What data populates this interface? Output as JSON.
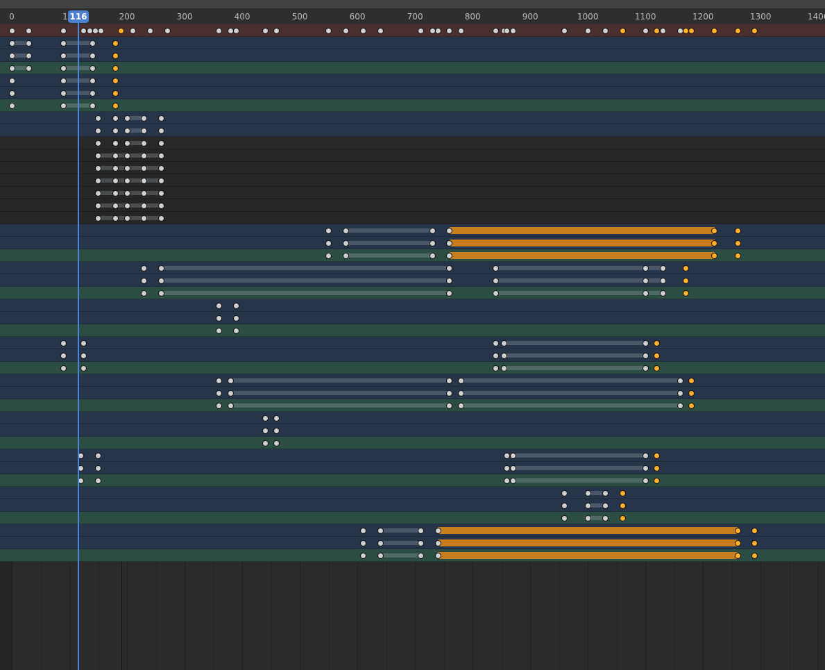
{
  "ruler": {
    "ticks": [
      "0",
      "1",
      "200",
      "300",
      "400",
      "500",
      "600",
      "700",
      "800",
      "900",
      "1000",
      "1100",
      "1200",
      "1300",
      "1400"
    ]
  },
  "playhead": {
    "frame": "116"
  },
  "scene_range": {
    "start": 0,
    "end": 195
  },
  "colors": {
    "selected_keyframe": "#ffaf29",
    "keyframe": "#cfcfcf",
    "hold_selected": "#c87e1f",
    "playhead": "#4c80cf",
    "summary_row": "#4a2f2f",
    "object_row": "#26354a",
    "action_row": "#2c4d44"
  },
  "keyframe_rows": [
    {
      "type": "summary",
      "keys": [
        0,
        30,
        90,
        125,
        135,
        145,
        155,
        190,
        210,
        240,
        270,
        360,
        380,
        390,
        440,
        460,
        550,
        580,
        610,
        640,
        710,
        730,
        740,
        760,
        780,
        840,
        855,
        860,
        870,
        960,
        1000,
        1030,
        1060,
        1100,
        1120,
        1130,
        1160,
        1170,
        1180,
        1220,
        1260,
        1290
      ],
      "sel": [
        190,
        1060,
        1120,
        1170,
        1180,
        1220,
        1260,
        1290
      ],
      "holds": []
    },
    {
      "type": "object",
      "keys": [
        0,
        30,
        90,
        140,
        180
      ],
      "sel": [
        180
      ],
      "holds": [
        [
          0,
          30
        ],
        [
          90,
          140
        ]
      ]
    },
    {
      "type": "object",
      "keys": [
        0,
        30,
        90,
        140,
        180
      ],
      "sel": [
        180
      ],
      "holds": [
        [
          0,
          30
        ],
        [
          90,
          140
        ]
      ]
    },
    {
      "type": "action",
      "keys": [
        0,
        30,
        90,
        140,
        180
      ],
      "sel": [
        180
      ],
      "holds": [
        [
          0,
          30
        ],
        [
          90,
          140
        ]
      ]
    },
    {
      "type": "object",
      "keys": [
        0,
        90,
        140,
        180
      ],
      "sel": [
        180
      ],
      "holds": [
        [
          90,
          140
        ]
      ]
    },
    {
      "type": "object",
      "keys": [
        0,
        90,
        140,
        180
      ],
      "sel": [
        180
      ],
      "holds": [
        [
          90,
          140
        ]
      ]
    },
    {
      "type": "action",
      "keys": [
        0,
        90,
        140,
        180
      ],
      "sel": [
        180
      ],
      "holds": [
        [
          90,
          140
        ]
      ]
    },
    {
      "type": "object",
      "keys": [
        150,
        180,
        200,
        230,
        260
      ],
      "sel": [],
      "holds": [
        [
          200,
          230
        ]
      ]
    },
    {
      "type": "object",
      "keys": [
        150,
        180,
        200,
        230,
        260
      ],
      "sel": [],
      "holds": [
        [
          200,
          230
        ]
      ]
    },
    {
      "type": "dim",
      "keys": [
        150,
        180,
        200,
        230,
        260
      ],
      "sel": [],
      "holds": [
        [
          200,
          230
        ]
      ]
    },
    {
      "type": "plain",
      "keys": [
        150,
        180,
        200,
        230,
        260
      ],
      "sel": [],
      "holds": [
        [
          150,
          260
        ]
      ]
    },
    {
      "type": "plain",
      "keys": [
        150,
        180,
        200,
        230,
        260
      ],
      "sel": [],
      "holds": [
        [
          150,
          260
        ]
      ]
    },
    {
      "type": "plain",
      "keys": [
        150,
        180,
        200,
        230,
        260
      ],
      "sel": [],
      "holds": [
        [
          150,
          260
        ]
      ]
    },
    {
      "type": "plain",
      "keys": [
        150,
        180,
        200,
        230,
        260
      ],
      "sel": [],
      "holds": [
        [
          150,
          260
        ]
      ]
    },
    {
      "type": "plain",
      "keys": [
        150,
        180,
        200,
        230,
        260
      ],
      "sel": [],
      "holds": [
        [
          150,
          260
        ]
      ]
    },
    {
      "type": "plain",
      "keys": [
        150,
        180,
        200,
        230,
        260
      ],
      "sel": [],
      "holds": [
        [
          150,
          260
        ]
      ]
    },
    {
      "type": "object",
      "keys": [
        550,
        580,
        730,
        760,
        1220,
        1260
      ],
      "sel": [
        1220,
        1260
      ],
      "holds": [
        [
          580,
          730
        ]
      ],
      "orange": [
        [
          760,
          1220
        ]
      ]
    },
    {
      "type": "object",
      "keys": [
        550,
        580,
        730,
        760,
        1220,
        1260
      ],
      "sel": [
        1220,
        1260
      ],
      "holds": [
        [
          580,
          730
        ]
      ],
      "orange": [
        [
          760,
          1220
        ]
      ]
    },
    {
      "type": "action",
      "keys": [
        550,
        580,
        730,
        760,
        1220,
        1260
      ],
      "sel": [
        1220,
        1260
      ],
      "holds": [
        [
          580,
          730
        ]
      ],
      "orange": [
        [
          760,
          1220
        ]
      ]
    },
    {
      "type": "object",
      "keys": [
        230,
        260,
        760,
        840,
        1100,
        1130,
        1170
      ],
      "sel": [
        1170
      ],
      "holds": [
        [
          260,
          760
        ],
        [
          840,
          1100
        ],
        [
          1100,
          1130
        ]
      ]
    },
    {
      "type": "object",
      "keys": [
        230,
        260,
        760,
        840,
        1100,
        1130,
        1170
      ],
      "sel": [
        1170
      ],
      "holds": [
        [
          260,
          760
        ],
        [
          840,
          1100
        ],
        [
          1100,
          1130
        ]
      ]
    },
    {
      "type": "action",
      "keys": [
        230,
        260,
        760,
        840,
        1100,
        1130,
        1170
      ],
      "sel": [
        1170
      ],
      "holds": [
        [
          260,
          760
        ],
        [
          840,
          1100
        ],
        [
          1100,
          1130
        ]
      ]
    },
    {
      "type": "object",
      "keys": [
        360,
        390
      ],
      "sel": [],
      "holds": []
    },
    {
      "type": "object",
      "keys": [
        360,
        390
      ],
      "sel": [],
      "holds": []
    },
    {
      "type": "action",
      "keys": [
        360,
        390
      ],
      "sel": [],
      "holds": []
    },
    {
      "type": "object",
      "keys": [
        90,
        125,
        840,
        855,
        1100,
        1120
      ],
      "sel": [
        1120
      ],
      "holds": [
        [
          855,
          1100
        ]
      ]
    },
    {
      "type": "object",
      "keys": [
        90,
        125,
        840,
        855,
        1100,
        1120
      ],
      "sel": [
        1120
      ],
      "holds": [
        [
          855,
          1100
        ]
      ]
    },
    {
      "type": "action",
      "keys": [
        90,
        125,
        840,
        855,
        1100,
        1120
      ],
      "sel": [
        1120
      ],
      "holds": [
        [
          855,
          1100
        ]
      ]
    },
    {
      "type": "object",
      "keys": [
        360,
        380,
        760,
        780,
        1160,
        1180
      ],
      "sel": [
        1180
      ],
      "holds": [
        [
          380,
          760
        ],
        [
          780,
          1160
        ]
      ]
    },
    {
      "type": "object",
      "keys": [
        360,
        380,
        760,
        780,
        1160,
        1180
      ],
      "sel": [
        1180
      ],
      "holds": [
        [
          380,
          760
        ],
        [
          780,
          1160
        ]
      ]
    },
    {
      "type": "action",
      "keys": [
        360,
        380,
        760,
        780,
        1160,
        1180
      ],
      "sel": [
        1180
      ],
      "holds": [
        [
          380,
          760
        ],
        [
          780,
          1160
        ]
      ]
    },
    {
      "type": "object",
      "keys": [
        440,
        460
      ],
      "sel": [],
      "holds": []
    },
    {
      "type": "object",
      "keys": [
        440,
        460
      ],
      "sel": [],
      "holds": []
    },
    {
      "type": "action",
      "keys": [
        440,
        460
      ],
      "sel": [],
      "holds": []
    },
    {
      "type": "object",
      "keys": [
        120,
        150,
        860,
        870,
        1100,
        1120
      ],
      "sel": [
        1120
      ],
      "holds": [
        [
          870,
          1100
        ]
      ]
    },
    {
      "type": "object",
      "keys": [
        120,
        150,
        860,
        870,
        1100,
        1120
      ],
      "sel": [
        1120
      ],
      "holds": [
        [
          870,
          1100
        ]
      ]
    },
    {
      "type": "action",
      "keys": [
        120,
        150,
        860,
        870,
        1100,
        1120
      ],
      "sel": [
        1120
      ],
      "holds": [
        [
          870,
          1100
        ]
      ]
    },
    {
      "type": "object",
      "keys": [
        960,
        1000,
        1030,
        1060
      ],
      "sel": [
        1060
      ],
      "holds": [
        [
          1000,
          1030
        ]
      ]
    },
    {
      "type": "object",
      "keys": [
        960,
        1000,
        1030,
        1060
      ],
      "sel": [
        1060
      ],
      "holds": [
        [
          1000,
          1030
        ]
      ]
    },
    {
      "type": "action",
      "keys": [
        960,
        1000,
        1030,
        1060
      ],
      "sel": [
        1060
      ],
      "holds": [
        [
          1000,
          1030
        ]
      ]
    },
    {
      "type": "object",
      "keys": [
        610,
        640,
        710,
        740,
        1260,
        1290
      ],
      "sel": [
        1260,
        1290
      ],
      "holds": [
        [
          640,
          710
        ]
      ],
      "orange": [
        [
          740,
          1260
        ]
      ]
    },
    {
      "type": "object",
      "keys": [
        610,
        640,
        710,
        740,
        1260,
        1290
      ],
      "sel": [
        1260,
        1290
      ],
      "holds": [
        [
          640,
          710
        ]
      ],
      "orange": [
        [
          740,
          1260
        ]
      ]
    },
    {
      "type": "action",
      "keys": [
        610,
        640,
        710,
        740,
        1260,
        1290
      ],
      "sel": [
        1260,
        1290
      ],
      "holds": [
        [
          640,
          710
        ]
      ],
      "orange": [
        [
          740,
          1260
        ]
      ]
    }
  ]
}
